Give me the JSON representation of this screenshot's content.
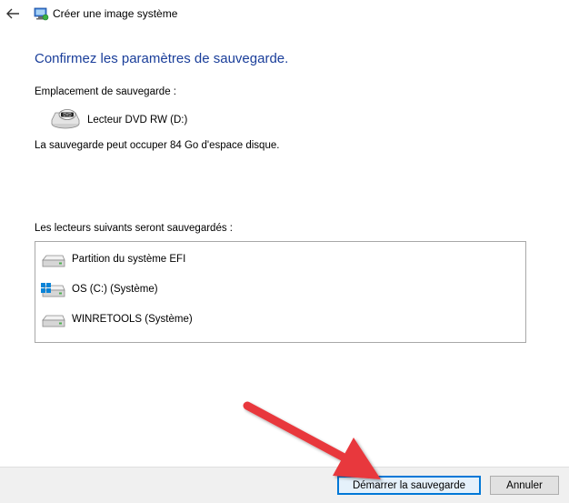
{
  "window": {
    "title": "Créer une image système",
    "back_icon": "back-arrow-icon",
    "app_icon": "system-image-icon"
  },
  "main": {
    "heading": "Confirmez les paramètres de sauvegarde.",
    "location_label": "Emplacement de sauvegarde :",
    "location_value": "Lecteur DVD RW (D:)",
    "location_icon": "dvd-drive-icon",
    "space_text": "La sauvegarde peut occuper 84 Go d'espace disque.",
    "drives_label": "Les lecteurs suivants seront sauvegardés :",
    "drives": [
      {
        "label": "Partition du système EFI",
        "icon": "hard-drive-icon"
      },
      {
        "label": "OS (C:) (Système)",
        "icon": "windows-drive-icon"
      },
      {
        "label": "WINRETOOLS (Système)",
        "icon": "hard-drive-icon"
      }
    ]
  },
  "footer": {
    "start_label": "Démarrer la sauvegarde",
    "cancel_label": "Annuler"
  },
  "colors": {
    "heading": "#1a3e9a",
    "primary_border": "#0078d7",
    "annotation_arrow": "#e8383d"
  }
}
